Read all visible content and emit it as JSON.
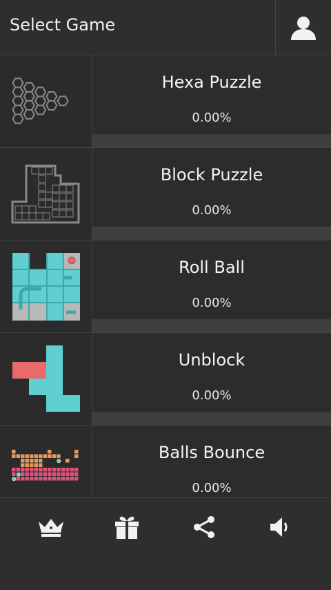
{
  "header": {
    "title": "Select Game",
    "profile_icon": "user-icon"
  },
  "games": [
    {
      "name": "Hexa Puzzle",
      "progress_text": "0.00%",
      "progress": 0,
      "thumbnail": "hexagon-grid"
    },
    {
      "name": "Block Puzzle",
      "progress_text": "0.00%",
      "progress": 0,
      "thumbnail": "block-grid"
    },
    {
      "name": "Roll Ball",
      "progress_text": "0.00%",
      "progress": 0,
      "thumbnail": "roll-ball-board"
    },
    {
      "name": "Unblock",
      "progress_text": "0.00%",
      "progress": 0,
      "thumbnail": "unblock-board"
    },
    {
      "name": "Balls Bounce",
      "progress_text": "0.00%",
      "progress": 0,
      "thumbnail": "balls-bounce-board"
    }
  ],
  "footer": {
    "icons": [
      "crown-icon",
      "gift-icon",
      "share-icon",
      "speaker-icon"
    ]
  },
  "colors": {
    "accent": "#5fcfd0",
    "block_red": "#e86a6a",
    "block_orange": "#e39a5a",
    "block_pink": "#e0507a",
    "outline_gray": "#8a8a8a"
  }
}
